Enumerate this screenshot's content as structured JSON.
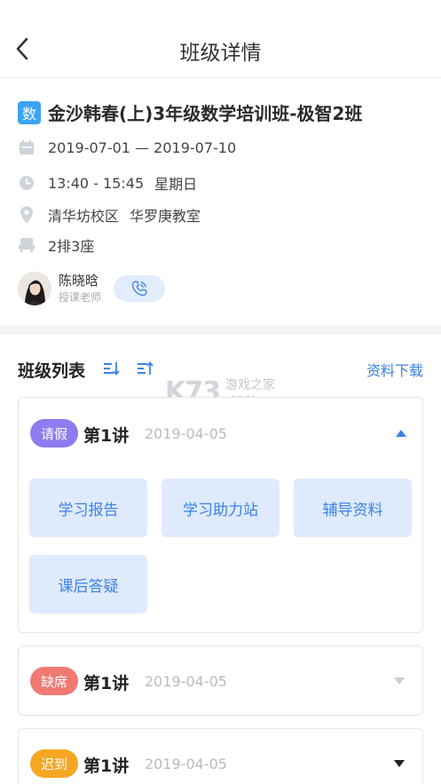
{
  "nav": {
    "title": "班级详情"
  },
  "course": {
    "subject_badge": "数",
    "title": "金沙韩春(上)3年级数学培训班-极智2班",
    "date_range": "2019-07-01 — 2019-07-10",
    "time": "13:40 - 15:45",
    "weekday": "星期日",
    "campus": "清华坊校区",
    "room": "华罗庚教室",
    "seat": "2排3座"
  },
  "teacher": {
    "name": "陈晓晗",
    "role": "授课老师"
  },
  "list": {
    "title": "班级列表",
    "download_label": "资料下载"
  },
  "lessons": [
    {
      "status": "请假",
      "status_color": "#8c7cf0",
      "name": "第1讲",
      "date": "2019-04-05",
      "expanded": true,
      "actions": [
        "学习报告",
        "学习助力站",
        "辅导资料",
        "课后答疑"
      ]
    },
    {
      "status": "缺席",
      "status_color": "#f07a72",
      "name": "第1讲",
      "date": "2019-04-05",
      "expanded": false
    },
    {
      "status": "迟到",
      "status_color": "#f5a623",
      "name": "第1讲",
      "date": "2019-04-05",
      "expanded": false
    }
  ],
  "watermark": {
    "logo": "K73",
    "line1": "游戏之家",
    "line2": ".com"
  },
  "colors": {
    "accent": "#3b82e8",
    "action_bg": "#dfeafd",
    "divider": "#f4f5f7"
  },
  "icons": [
    "back-icon",
    "calendar-icon",
    "clock-icon",
    "location-icon",
    "seat-icon",
    "phone-icon",
    "sort-ascending-icon",
    "sort-descending-icon",
    "caret-up-icon",
    "caret-down-icon"
  ]
}
